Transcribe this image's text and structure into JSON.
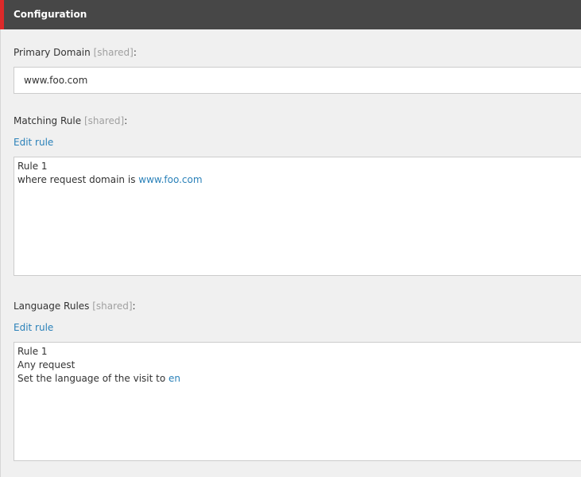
{
  "section": {
    "title": "Configuration"
  },
  "primary_domain": {
    "label": "Primary Domain",
    "shared_tag": "[shared]",
    "colon": ":",
    "value": "www.foo.com"
  },
  "matching_rule": {
    "label": "Matching Rule",
    "shared_tag": "[shared]",
    "colon": ":",
    "edit_label": "Edit rule",
    "rule": {
      "name": "Rule 1",
      "condition_prefix": "where request domain is ",
      "condition_value": "www.foo.com"
    }
  },
  "language_rules": {
    "label": "Language Rules",
    "shared_tag": "[shared]",
    "colon": ":",
    "edit_label": "Edit rule",
    "rule": {
      "name": "Rule 1",
      "condition": "Any request",
      "action_prefix": "Set the language of the visit to ",
      "action_value": "en"
    }
  },
  "colors": {
    "header_bg": "#474747",
    "header_accent": "#dc2a2a",
    "link": "#2a81b9",
    "shared_text": "#a0a0a0",
    "page_bg": "#f0f0f0"
  }
}
